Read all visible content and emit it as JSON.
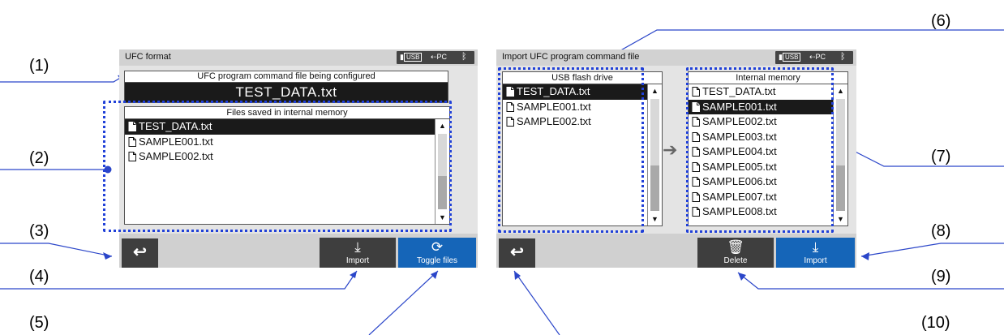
{
  "callouts": [
    "(1)",
    "(2)",
    "(3)",
    "(4)",
    "(5)",
    "(6)",
    "(7)",
    "(8)",
    "(9)",
    "(10)"
  ],
  "left_screen": {
    "title": "UFC format",
    "status": {
      "usb": "USB",
      "pc": "PC"
    },
    "config_label": "UFC program command file being configured",
    "config_file": "TEST_DATA.txt",
    "files_header": "Files saved in internal memory",
    "files": [
      "TEST_DATA.txt",
      "SAMPLE001.txt",
      "SAMPLE002.txt"
    ],
    "selected_file": "TEST_DATA.txt",
    "buttons": {
      "import": "Import",
      "toggle": "Toggle files"
    }
  },
  "right_screen": {
    "title": "Import UFC program command file",
    "status": {
      "usb": "USB",
      "pc": "PC"
    },
    "usb_header": "USB flash drive",
    "usb_files": [
      "TEST_DATA.txt",
      "SAMPLE001.txt",
      "SAMPLE002.txt"
    ],
    "usb_selected": "TEST_DATA.txt",
    "memory_header": "Internal memory",
    "memory_files": [
      "TEST_DATA.txt",
      "SAMPLE001.txt",
      "SAMPLE002.txt",
      "SAMPLE003.txt",
      "SAMPLE004.txt",
      "SAMPLE005.txt",
      "SAMPLE006.txt",
      "SAMPLE007.txt",
      "SAMPLE008.txt"
    ],
    "memory_selected": "SAMPLE001.txt",
    "buttons": {
      "delete": "Delete",
      "import": "Import"
    }
  },
  "colors": {
    "accent_blue": "#1565b8",
    "dotted_outline": "#2040d8",
    "dark_button": "#3e3e3e"
  }
}
